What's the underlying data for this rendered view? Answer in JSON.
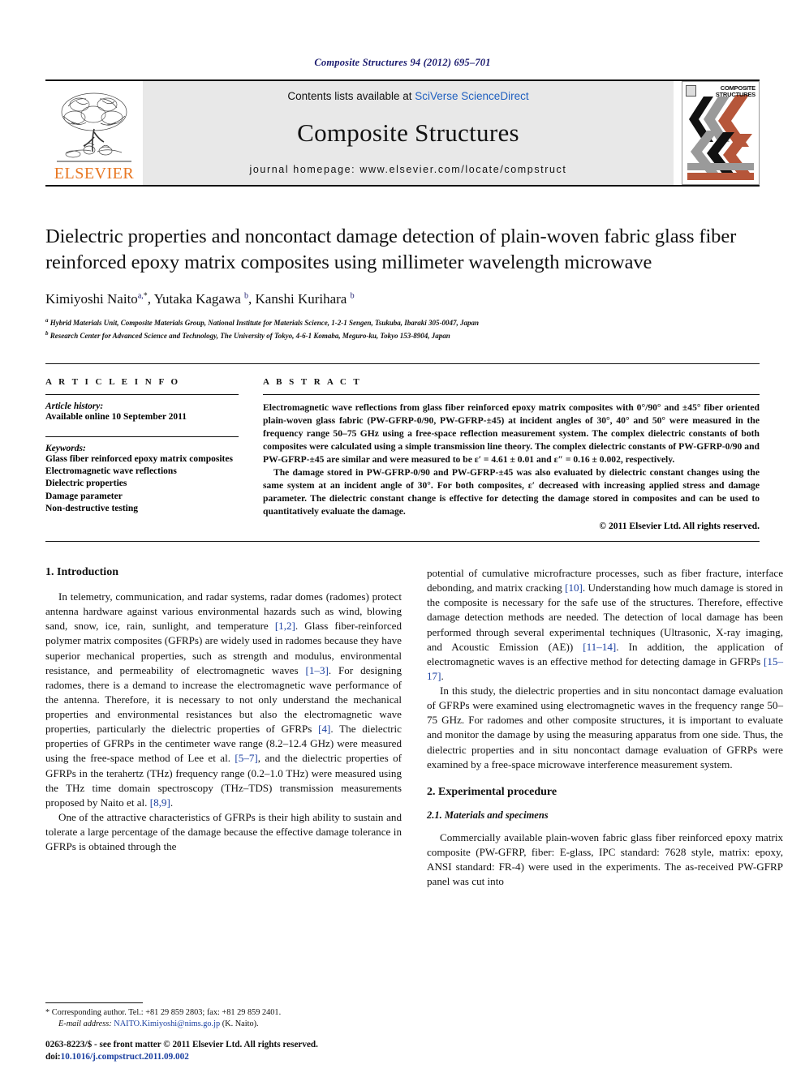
{
  "running_head": "Composite Structures 94 (2012) 695–701",
  "masthead": {
    "publisher_name": "ELSEVIER",
    "contents_prefix": "Contents lists available at ",
    "contents_link": "SciVerse ScienceDirect",
    "journal_name": "Composite Structures",
    "homepage_line": "journal homepage: www.elsevier.com/locate/compstruct",
    "cover_title_line1": "COMPOSITE",
    "cover_title_line2": "STRUCTURES",
    "link_color": "#1f5fbf",
    "brand_color": "#E87722"
  },
  "article": {
    "title": "Dielectric properties and noncontact damage detection of plain-woven fabric glass fiber reinforced epoxy matrix composites using millimeter wavelength microwave",
    "authors_html": "Kimiyoshi Naito<sup class=\"aff\">a,</sup><sup class=\"star\">*</sup>, Yutaka Kagawa <sup class=\"aff\">b</sup>, Kanshi Kurihara <sup class=\"aff\">b</sup>",
    "affiliation_a": "Hybrid Materials Unit, Composite Materials Group, National Institute for Materials Science, 1-2-1 Sengen, Tsukuba, Ibaraki 305-0047, Japan",
    "affiliation_b": "Research Center for Advanced Science and Technology, The University of Tokyo, 4-6-1 Komaba, Meguro-ku, Tokyo 153-8904, Japan"
  },
  "info": {
    "heading": "A R T I C L E  I N F O",
    "history_label": "Article history:",
    "history_value": "Available online 10 September 2011",
    "keywords_label": "Keywords:",
    "keywords": [
      "Glass fiber reinforced epoxy matrix composites",
      "Electromagnetic wave reflections",
      "Dielectric properties",
      "Damage parameter",
      "Non-destructive testing"
    ]
  },
  "abstract": {
    "heading": "A B S T R A C T",
    "paragraph1": "Electromagnetic wave reflections from glass fiber reinforced epoxy matrix composites with 0°/90° and ±45° fiber oriented plain-woven glass fabric (PW-GFRP-0/90, PW-GFRP-±45) at incident angles of 30°, 40° and 50° were measured in the frequency range 50–75 GHz using a free-space reflection measurement system. The complex dielectric constants of both composites were calculated using a simple transmission line theory. The complex dielectric constants of PW-GFRP-0/90 and PW-GFRP-±45 are similar and were measured to be ε′ = 4.61 ± 0.01 and ε″ = 0.16 ± 0.002, respectively.",
    "paragraph2": "The damage stored in PW-GFRP-0/90 and PW-GFRP-±45 was also evaluated by dielectric constant changes using the same system at an incident angle of 30°. For both composites, ε′ decreased with increasing applied stress and damage parameter. The dielectric constant change is effective for detecting the damage stored in composites and can be used to quantitatively evaluate the damage.",
    "copyright": "© 2011 Elsevier Ltd. All rights reserved."
  },
  "body": {
    "section1_title": "1. Introduction",
    "left_p1": "In telemetry, communication, and radar systems, radar domes (radomes) protect antenna hardware against various environmental hazards such as wind, blowing sand, snow, ice, rain, sunlight, and temperature [1,2]. Glass fiber-reinforced polymer matrix composites (GFRPs) are widely used in radomes because they have superior mechanical properties, such as strength and modulus, environmental resistance, and permeability of electromagnetic waves [1–3]. For designing radomes, there is a demand to increase the electromagnetic wave performance of the antenna. Therefore, it is necessary to not only understand the mechanical properties and environmental resistances but also the electromagnetic wave properties, particularly the dielectric properties of GFRPs [4]. The dielectric properties of GFRPs in the centimeter wave range (8.2–12.4 GHz) were measured using the free-space method of Lee et al. [5–7], and the dielectric properties of GFRPs in the terahertz (THz) frequency range (0.2–1.0 THz) were measured using the THz time domain spectroscopy (THz–TDS) transmission measurements proposed by Naito et al. [8,9].",
    "left_p2": "One of the attractive characteristics of GFRPs is their high ability to sustain and tolerate a large percentage of the damage because the effective damage tolerance in GFRPs is obtained through the",
    "right_p1": "potential of cumulative microfracture processes, such as fiber fracture, interface debonding, and matrix cracking [10]. Understanding how much damage is stored in the composite is necessary for the safe use of the structures. Therefore, effective damage detection methods are needed. The detection of local damage has been performed through several experimental techniques (Ultrasonic, X-ray imaging, and Acoustic Emission (AE)) [11–14]. In addition, the application of electromagnetic waves is an effective method for detecting damage in GFRPs [15–17].",
    "right_p2": "In this study, the dielectric properties and in situ noncontact damage evaluation of GFRPs were examined using electromagnetic waves in the frequency range 50–75 GHz. For radomes and other composite structures, it is important to evaluate and monitor the damage by using the measuring apparatus from one side. Thus, the dielectric properties and in situ noncontact damage evaluation of GFRPs were examined by a free-space microwave interference measurement system.",
    "section2_title": "2. Experimental procedure",
    "subsection21_title": "2.1. Materials and specimens",
    "right_p3": "Commercially available plain-woven fabric glass fiber reinforced epoxy matrix composite (PW-GFRP, fiber: E-glass, IPC standard: 7628 style, matrix: epoxy, ANSI standard: FR-4) were used in the experiments. The as-received PW-GFRP panel was cut into"
  },
  "footer": {
    "corresponding_marker": "*",
    "corresponding_text": "Corresponding author. Tel.: +81 29 859 2803; fax: +81 29 859 2401.",
    "email_label": "E-mail address:",
    "email": "NAITO.Kimiyoshi@nims.go.jp",
    "email_owner": "(K. Naito).",
    "issn_line": "0263-8223/$ - see front matter © 2011 Elsevier Ltd. All rights reserved.",
    "doi_prefix": "doi:",
    "doi": "10.1016/j.compstruct.2011.09.002"
  }
}
